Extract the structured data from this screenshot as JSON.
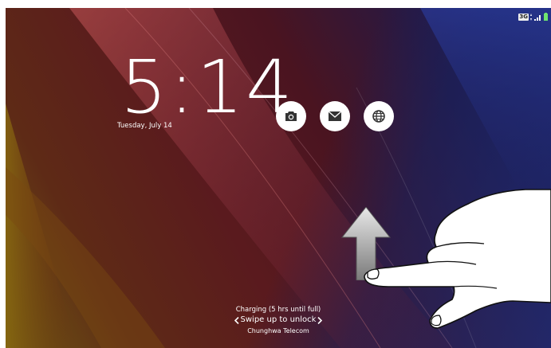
{
  "lock_screen": {
    "time": "5:14",
    "date": "Tuesday, July 14"
  },
  "status_bar": {
    "network_type": "3G"
  },
  "shortcuts": [
    {
      "icon": "camera-icon"
    },
    {
      "icon": "mail-icon"
    },
    {
      "icon": "browser-icon"
    }
  ],
  "footer": {
    "charging": "Charging (5 hrs until full)",
    "swipe_hint": "Swipe up to unlock",
    "carrier": "Chunghwa Telecom"
  }
}
